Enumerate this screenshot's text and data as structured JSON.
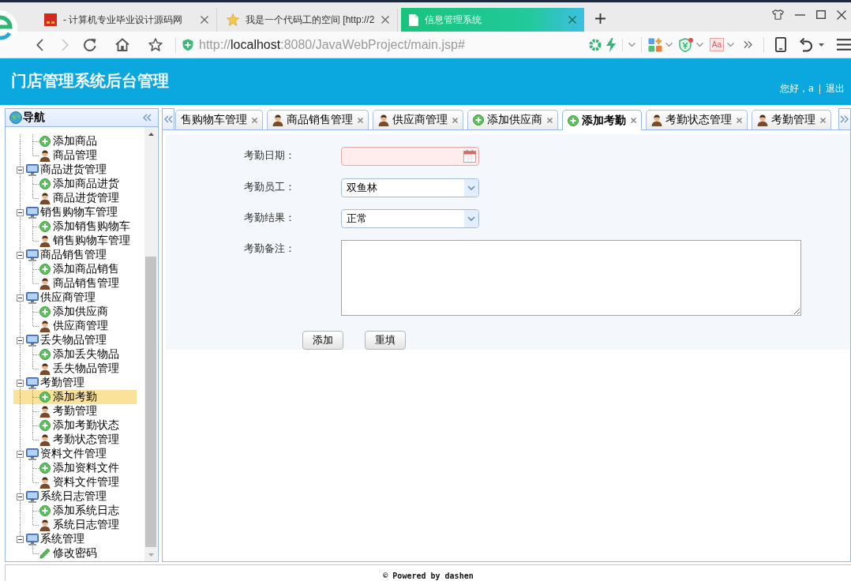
{
  "browser": {
    "tabs": [
      {
        "title": "- 计算机专业毕业设计源码网",
        "selected": false
      },
      {
        "title": "我是一个代码工的空间 [http://2",
        "selected": false
      },
      {
        "title": "信息管理系统",
        "selected": true
      }
    ],
    "address": {
      "scheme": "http://",
      "host": "localhost",
      "path": ":8080/JavaWebProject/main.jsp#"
    },
    "font_button": "Aa"
  },
  "header": {
    "title": "门店管理系统后台管理",
    "greeting": "您好，a",
    "logout": "退出"
  },
  "nav": {
    "title": "导航",
    "tree": [
      {
        "children": [
          {
            "label": "添加商品",
            "kind": "add",
            "selected": false
          },
          {
            "label": "商品管理",
            "kind": "manage",
            "selected": false
          }
        ]
      },
      {
        "label": "商品进货管理",
        "kind": "module",
        "expanded": true,
        "selected": false,
        "children": [
          {
            "label": "添加商品进货",
            "kind": "add",
            "selected": false
          },
          {
            "label": "商品进货管理",
            "kind": "manage",
            "selected": false
          }
        ]
      },
      {
        "label": "销售购物车管理",
        "kind": "module",
        "expanded": true,
        "selected": false,
        "children": [
          {
            "label": "添加销售购物车",
            "kind": "add",
            "selected": false
          },
          {
            "label": "销售购物车管理",
            "kind": "manage",
            "selected": false
          }
        ]
      },
      {
        "label": "商品销售管理",
        "kind": "module",
        "expanded": true,
        "selected": false,
        "children": [
          {
            "label": "添加商品销售",
            "kind": "add",
            "selected": false
          },
          {
            "label": "商品销售管理",
            "kind": "manage",
            "selected": false
          }
        ]
      },
      {
        "label": "供应商管理",
        "kind": "module",
        "expanded": true,
        "selected": false,
        "children": [
          {
            "label": "添加供应商",
            "kind": "add",
            "selected": false
          },
          {
            "label": "供应商管理",
            "kind": "manage",
            "selected": false
          }
        ]
      },
      {
        "label": "丢失物品管理",
        "kind": "module",
        "expanded": true,
        "selected": false,
        "children": [
          {
            "label": "添加丢失物品",
            "kind": "add",
            "selected": false
          },
          {
            "label": "丢失物品管理",
            "kind": "manage",
            "selected": false
          }
        ]
      },
      {
        "label": "考勤管理",
        "kind": "module",
        "expanded": true,
        "selected": false,
        "children": [
          {
            "label": "添加考勤",
            "kind": "add",
            "selected": true
          },
          {
            "label": "考勤管理",
            "kind": "manage",
            "selected": false
          },
          {
            "label": "添加考勤状态",
            "kind": "add",
            "selected": false
          },
          {
            "label": "考勤状态管理",
            "kind": "manage",
            "selected": false
          }
        ]
      },
      {
        "label": "资料文件管理",
        "kind": "module",
        "expanded": true,
        "selected": false,
        "children": [
          {
            "label": "添加资料文件",
            "kind": "add",
            "selected": false
          },
          {
            "label": "资料文件管理",
            "kind": "manage",
            "selected": false
          }
        ]
      },
      {
        "label": "系统日志管理",
        "kind": "module",
        "expanded": true,
        "selected": false,
        "children": [
          {
            "label": "添加系统日志",
            "kind": "add",
            "selected": false
          },
          {
            "label": "系统日志管理",
            "kind": "manage",
            "selected": false
          }
        ]
      },
      {
        "label": "系统管理",
        "kind": "module",
        "expanded": true,
        "selected": false,
        "children": [
          {
            "label": "修改密码",
            "kind": "edit",
            "selected": false
          }
        ]
      }
    ]
  },
  "tabs": [
    {
      "label": "售购物车管理",
      "kind": "plain",
      "selected": false
    },
    {
      "label": "商品销售管理",
      "kind": "manage",
      "selected": false
    },
    {
      "label": "供应商管理",
      "kind": "manage",
      "selected": false
    },
    {
      "label": "添加供应商",
      "kind": "add",
      "selected": false
    },
    {
      "label": "添加考勤",
      "kind": "add",
      "selected": true
    },
    {
      "label": "考勤状态管理",
      "kind": "manage",
      "selected": false
    },
    {
      "label": "考勤管理",
      "kind": "manage",
      "selected": false
    }
  ],
  "form": {
    "fields": [
      {
        "label": "考勤日期：",
        "kind": "date",
        "invalid": true
      },
      {
        "label": "考勤员工：",
        "kind": "select",
        "value": "双鱼林",
        "invalid": false
      },
      {
        "label": "考勤结果：",
        "kind": "select",
        "value": "正常",
        "invalid": false
      },
      {
        "label": "考勤备注：",
        "kind": "textarea",
        "invalid": false
      }
    ],
    "buttons": [
      "添加",
      "重填"
    ]
  },
  "footer": "© Powered by dashen"
}
